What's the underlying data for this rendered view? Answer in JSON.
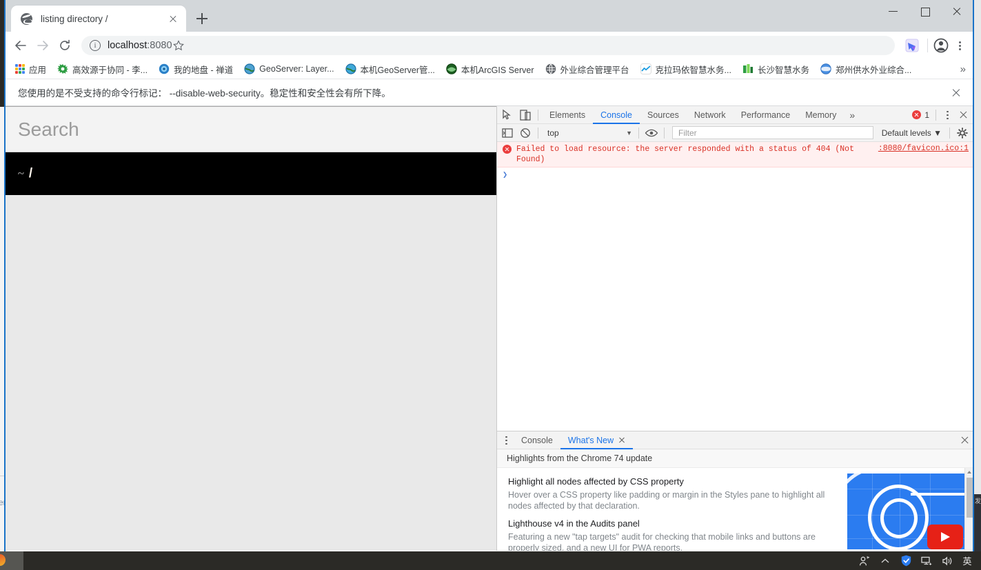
{
  "window": {
    "controls": {
      "minimize": "minimize-button",
      "maximize": "maximize-button",
      "close": "close-button"
    }
  },
  "tabs": [
    {
      "title": "listing directory /",
      "favicon": "globe-icon",
      "active": true
    }
  ],
  "newtab_label": "+",
  "omnibox": {
    "back": "back-arrow-icon",
    "forward": "forward-arrow-icon",
    "reload": "reload-icon",
    "site_info_glyph": "i",
    "url_host": "localhost",
    "url_port": ":8080",
    "star": "star-icon",
    "extension": "extension-icon",
    "profile": "account-avatar-icon",
    "menu": "three-dot-menu-icon"
  },
  "bookmarks": {
    "apps_label": "应用",
    "items": [
      {
        "label": "高效源于协同 - 李...",
        "icon_color": "#2f9e44"
      },
      {
        "label": "我的地盘 - 禅道",
        "icon_color": "#2a80c8"
      },
      {
        "label": "GeoServer: Layer...",
        "icon_color": "#4fa3d1"
      },
      {
        "label": "本机GeoServer管...",
        "icon_color": "#3fa9d8"
      },
      {
        "label": "本机ArcGIS Server",
        "icon_color": "#2e7d32"
      },
      {
        "label": "外业综合管理平台",
        "icon_color": "#555555"
      },
      {
        "label": "克拉玛依智慧水务...",
        "icon_color": "#1a9be0"
      },
      {
        "label": "长沙智慧水务",
        "icon_color": "#3cb44b"
      },
      {
        "label": "郑州供水外业综合...",
        "icon_color": "#3d7fd4"
      }
    ],
    "overflow": "»"
  },
  "infobar": {
    "message": "您使用的是不受支持的命令行标记： --disable-web-security。稳定性和安全性会有所下降。",
    "close": "close-infobar-button"
  },
  "page": {
    "search_placeholder": "Search",
    "search_value": "",
    "path_tilde": "~",
    "path_slash": "/"
  },
  "devtools": {
    "inspect_icon": "inspect-element-icon",
    "device_icon": "device-toolbar-icon",
    "panels": [
      {
        "label": "Elements",
        "active": false
      },
      {
        "label": "Console",
        "active": true
      },
      {
        "label": "Sources",
        "active": false
      },
      {
        "label": "Network",
        "active": false
      },
      {
        "label": "Performance",
        "active": false
      },
      {
        "label": "Memory",
        "active": false
      }
    ],
    "more_panels": "»",
    "error_count": "1",
    "kebab": "devtools-more-options-icon",
    "close": "devtools-close-icon",
    "console_toolbar": {
      "sidebar_toggle": "console-sidebar-icon",
      "clear": "clear-console-icon",
      "context": "top",
      "context_caret": "▼",
      "eye": "live-expression-icon",
      "filter_placeholder": "Filter",
      "filter_value": "",
      "levels": "Default levels ▼",
      "settings": "settings-gear-icon"
    },
    "console_messages": [
      {
        "severity": "error",
        "text": "Failed to load resource: the server responded with a status of 404 (Not Found)",
        "source": ":8080/favicon.ico:1"
      }
    ],
    "prompt_glyph": "❯",
    "drawer": {
      "kebab": "drawer-more-options-icon",
      "tabs": [
        {
          "label": "Console",
          "active": false,
          "closable": false
        },
        {
          "label": "What's New",
          "active": true,
          "closable": true
        }
      ],
      "close": "drawer-close-icon",
      "header": "Highlights from the Chrome 74 update",
      "items": [
        {
          "title": "Highlight all nodes affected by CSS property",
          "desc": "Hover over a CSS property like padding or margin in the Styles pane to highlight all nodes affected by that declaration."
        },
        {
          "title": "Lighthouse v4 in the Audits panel",
          "desc": "Featuring a new \"tap targets\" audit for checking that mobile links and buttons are properly sized, and a new UI for PWA reports."
        }
      ],
      "thumbnail": "chrome-devtools-video-thumbnail"
    }
  },
  "taskbar": {
    "tray": [
      {
        "name": "people-icon"
      },
      {
        "name": "show-hidden-icons-chevron"
      },
      {
        "name": "security-shield-icon"
      },
      {
        "name": "network-icon"
      },
      {
        "name": "volume-icon"
      }
    ],
    "ime_label": "英"
  },
  "desktop": {
    "left_fragment_text": "er",
    "right_fragment_text": "发"
  },
  "colors": {
    "accent_blue": "#1a73e8",
    "error_red": "#d93025",
    "window_border": "#1a73c8",
    "taskbar": "#2b2a26"
  }
}
